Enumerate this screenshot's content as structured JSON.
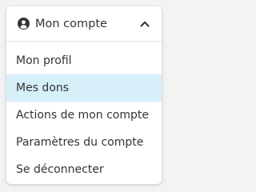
{
  "account_menu": {
    "header_label": "Mon compte",
    "header_icon": "user-circle-icon",
    "toggle_icon": "chevron-up-icon",
    "items": [
      {
        "label": "Mon profil",
        "active": false
      },
      {
        "label": "Mes dons",
        "active": true
      },
      {
        "label": "Actions de mon compte",
        "active": false
      },
      {
        "label": "Paramètres du compte",
        "active": false
      },
      {
        "label": "Se déconnecter",
        "active": false
      }
    ]
  },
  "colors": {
    "highlight": "#d6eff9",
    "text": "#333333",
    "border": "#e1e1e1",
    "icon": "#333333"
  }
}
